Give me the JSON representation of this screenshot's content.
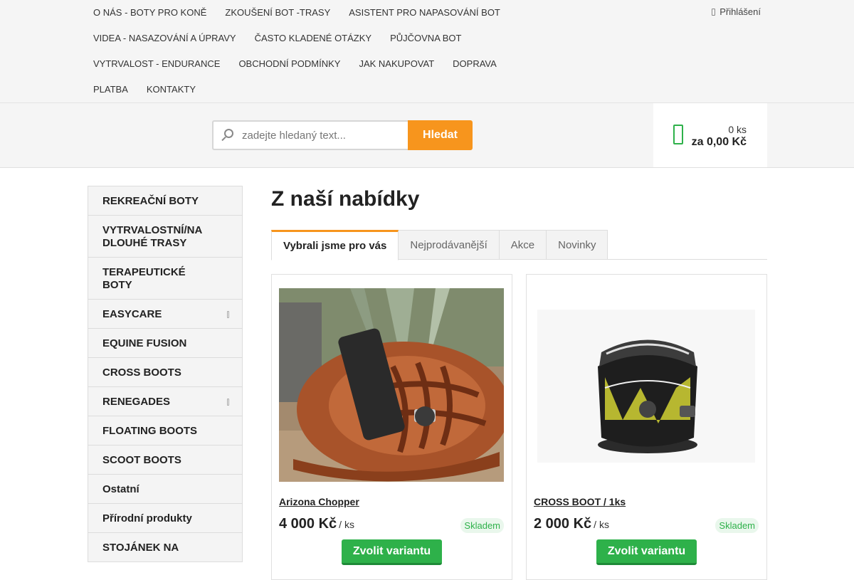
{
  "nav": {
    "rows": [
      [
        "O NÁS - BOTY PRO KONĚ",
        "ZKOUŠENÍ BOT -TRASY",
        "ASISTENT PRO NAPASOVÁNÍ BOT"
      ],
      [
        "VIDEA - NASAZOVÁNÍ A ÚPRAVY",
        "ČASTO KLADENÉ OTÁZKY",
        "PŮJČOVNA BOT"
      ],
      [
        "VYTRVALOST - ENDURANCE",
        "OBCHODNÍ PODMÍNKY",
        "JAK NAKUPOVAT",
        "DOPRAVA"
      ],
      [
        "PLATBA",
        "KONTAKTY"
      ]
    ],
    "login_label": "Přihlášení",
    "login_icon": "user-icon"
  },
  "search": {
    "placeholder": "zadejte hledaný text...",
    "button_label": "Hledat",
    "icon": "search-icon"
  },
  "cart": {
    "icon": "cart-icon",
    "quantity": "0 ks",
    "total": "za 0,00 Kč"
  },
  "sidebar": {
    "items": [
      {
        "label": "REKREAČNÍ BOTY",
        "has_submenu": false
      },
      {
        "label": "VYTRVALOSTNÍ/NA DLOUHÉ TRASY",
        "has_submenu": false
      },
      {
        "label": "TERAPEUTICKÉ BOTY",
        "has_submenu": false
      },
      {
        "label": "EASYCARE",
        "has_submenu": true
      },
      {
        "label": "EQUINE FUSION",
        "has_submenu": false
      },
      {
        "label": "CROSS BOOTS",
        "has_submenu": false
      },
      {
        "label": "RENEGADES",
        "has_submenu": true
      },
      {
        "label": "FLOATING BOOTS",
        "has_submenu": false
      },
      {
        "label": "SCOOT BOOTS",
        "has_submenu": false
      },
      {
        "label": "Ostatní",
        "has_submenu": false
      },
      {
        "label": "Přírodní produkty",
        "has_submenu": false
      },
      {
        "label": "STOJÁNEK NA",
        "has_submenu": false
      }
    ]
  },
  "main": {
    "title": "Z naší nabídky",
    "tabs": [
      {
        "label": "Vybrali jsme pro vás",
        "active": true
      },
      {
        "label": "Nejprodávanější",
        "active": false
      },
      {
        "label": "Akce",
        "active": false
      },
      {
        "label": "Novinky",
        "active": false
      }
    ],
    "products": [
      {
        "name": "Arizona Chopper",
        "price": "4 000 Kč",
        "unit": "/ ks",
        "stock": "Skladem",
        "button": "Zvolit variantu"
      },
      {
        "name": "CROSS BOOT / 1ks",
        "price": "2 000 Kč",
        "unit": "/ ks",
        "stock": "Skladem",
        "button": "Zvolit variantu"
      }
    ]
  },
  "colors": {
    "accent_orange": "#f7951d",
    "accent_green": "#2eb14a"
  }
}
